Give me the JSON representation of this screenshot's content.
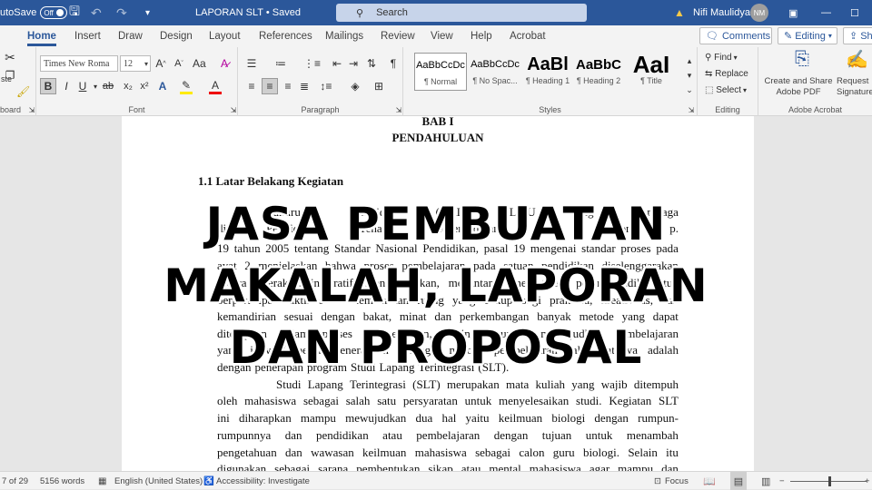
{
  "titlebar": {
    "autosave": "utoSave",
    "toggle": "Off",
    "doc": "LAPORAN SLT • Saved",
    "search": "Search",
    "user": "Nifi Maulidya",
    "initials": "NM"
  },
  "tabs": [
    "Home",
    "Insert",
    "Draw",
    "Design",
    "Layout",
    "References",
    "Mailings",
    "Review",
    "View",
    "Help",
    "Acrobat"
  ],
  "tab_buttons": {
    "comments": "Comments",
    "editing": "Editing",
    "share": "Sh"
  },
  "ribbon": {
    "clipboard_label": "board",
    "paste": "ste",
    "font_name": "Times New Roma",
    "font_size": "12",
    "font_label": "Font",
    "paragraph_label": "Paragraph",
    "styles": [
      {
        "preview": "AaBbCcDc",
        "name": "¶ Normal"
      },
      {
        "preview": "AaBbCcDc",
        "name": "¶ No Spac..."
      },
      {
        "preview": "AaBl",
        "name": "¶ Heading 1"
      },
      {
        "preview": "AaBbC",
        "name": "¶ Heading 2"
      },
      {
        "preview": "AaI",
        "name": "¶ Title"
      }
    ],
    "styles_label": "Styles",
    "editing": {
      "find": "Find",
      "replace": "Replace",
      "select": "Select",
      "label": "Editing"
    },
    "acrobat": {
      "create": "Create and Share",
      "create2": "Adobe PDF",
      "request": "Request",
      "request2": "Signatures",
      "label": "Adobe Acrobat"
    }
  },
  "document": {
    "chapter": "BAB I",
    "chapter_title": "PENDAHULUAN",
    "section": "1.1 Latar Belakang Kegiatan",
    "lines": [
      "kukuruan Pendidik (KKI) ILMU ang Lembaga",
      "di Pendidikan Tenaga Kependidikan dan Nomor p.",
      "19 tahun 2005 tentang Standar Nasional Pendidikan, pasal 19 mengenai standar proses pada",
      "ayat 2 menjelaskan bahwa proses pembelajaran pada satuan pendidikan diselenggarakan",
      "secara interaktif, inspiratif, menyenangkan, menantang, memotivasi peserta didik untuk",
      "berpartisipasi aktif serta memberikan ruang yang cukup bagi prakarsa, kreativitas, dan",
      "kemandirian sesuai dengan bakat, minat dan perkembangan banyak metode yang dapat",
      "diterapkan dalam proses pembelajaran, sehingga untuk mewujudkan pembelajaran",
      "yang inovatif perlu menerapkan berbagai metode pembelajaran salah satunya adalah",
      "dengan penerapan program Studi Lapang Terintegrasi (SLT).",
      "Studi Lapang Terintegrasi (SLT) merupakan mata kuliah yang wajib ditempuh",
      "oleh mahasiswa sebagai salah satu persyaratan untuk menyelesaikan studi. Kegiatan SLT",
      "ini diharapkan mampu mewujudkan dua hal yaitu keilmuan biologi dengan rumpun-",
      "rumpunnya dan pendidikan atau pembelajaran dengan tujuan untuk menambah",
      "pengetahuan dan wawasan keilmuan mahasiswa sebagai calon guru biologi. Selain itu",
      "digunakan sebagai sarana pembentukan sikap atau mental mahasiswa agar mampu dan"
    ]
  },
  "overlay": [
    "JASA PEMBUATAN",
    "MAKALAH, LAPORAN",
    "DAN PROPOSAL"
  ],
  "statusbar": {
    "page": "7 of 29",
    "words": "5156 words",
    "language": "English (United States)",
    "accessibility": "Accessibility: Investigate",
    "focus": "Focus"
  },
  "colors": {
    "accent": "#2b579a"
  }
}
